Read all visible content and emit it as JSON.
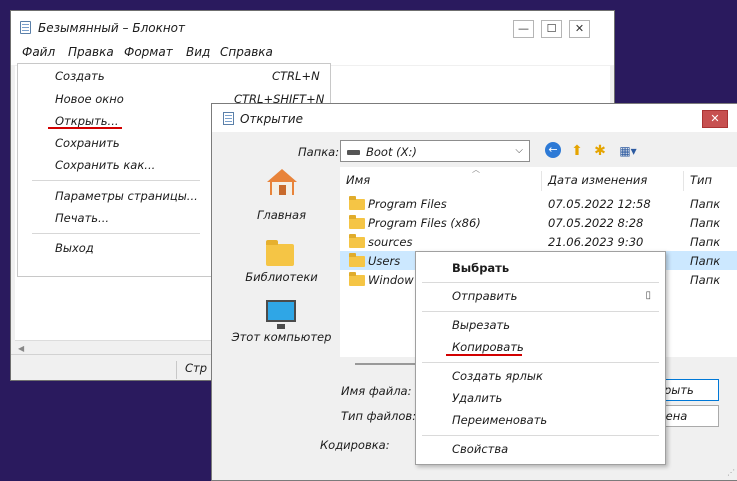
{
  "notepad": {
    "title": "Безымянный – Блокнот",
    "controls": {
      "minimize": "—",
      "maximize": "☐",
      "close": "✕"
    },
    "menubar": [
      "Файл",
      "Правка",
      "Формат",
      "Вид",
      "Справка"
    ],
    "file_menu": [
      {
        "label": "Создать",
        "shortcut": "CTRL+N"
      },
      {
        "label": "Новое окно",
        "shortcut": "CTRL+SHIFT+N"
      },
      {
        "label": "Открыть...",
        "shortcut": ""
      },
      {
        "label": "Сохранить",
        "shortcut": ""
      },
      {
        "label": "Сохранить как...",
        "shortcut": ""
      },
      {
        "label": "Параметры страницы...",
        "shortcut": ""
      },
      {
        "label": "Печать...",
        "shortcut": ""
      },
      {
        "label": "Выход",
        "shortcut": ""
      }
    ],
    "status_text": "Стр",
    "highlight_color": "#d20000"
  },
  "dialog": {
    "title": "Открытие",
    "close": "✕",
    "folder_label": "Папка:",
    "folder_value": "Boot (X:)",
    "places": [
      "Главная",
      "Библиотеки",
      "Этот компьютер"
    ],
    "columns": [
      "Имя",
      "Дата изменения",
      "Тип"
    ],
    "files": [
      {
        "name": "Program Files",
        "date": "07.05.2022 12:58",
        "type": "Папк"
      },
      {
        "name": "Program Files (x86)",
        "date": "07.05.2022 8:28",
        "type": "Папк"
      },
      {
        "name": "sources",
        "date": "21.06.2023 9:30",
        "type": "Папк"
      },
      {
        "name": "Users",
        "date": "",
        "type": "Папк"
      },
      {
        "name": "Window",
        "date": "",
        "type": "Папк"
      }
    ],
    "filename_label": "Имя файла:",
    "filetype_label": "Тип файлов:",
    "encoding_label": "Кодировка:",
    "open_button": "крыть",
    "cancel_button": "мена",
    "selection_color": "#cce8ff"
  },
  "context_menu": {
    "items": [
      "Выбрать",
      "Отправить",
      "Вырезать",
      "Копировать",
      "Создать ярлык",
      "Удалить",
      "Переименовать",
      "Свойства"
    ]
  },
  "icons": [
    "notepad-icon",
    "drive-icon",
    "back-icon",
    "up-folder-icon",
    "new-folder-icon",
    "view-menu-icon",
    "home-icon",
    "libraries-icon",
    "computer-icon",
    "folder-icon"
  ]
}
